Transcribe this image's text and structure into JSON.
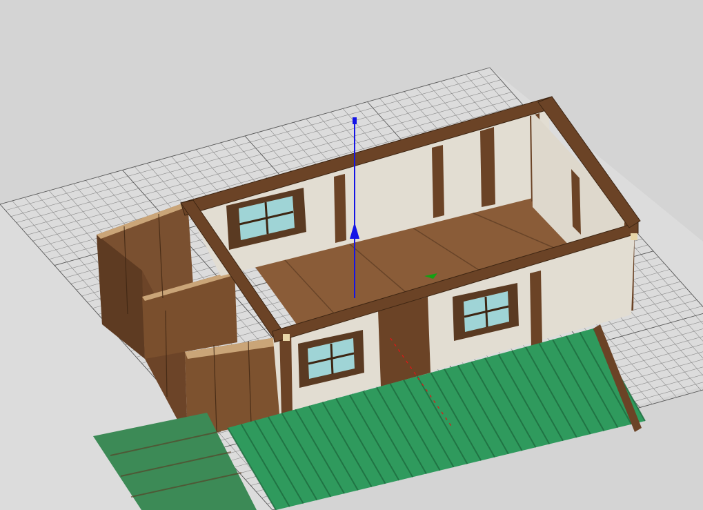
{
  "viewport": {
    "background": "#d4d4d4",
    "grid_line_color": "#8a8a8a",
    "grid_major_color": "#555555"
  },
  "model": {
    "wall_plaster": "#e2ddd2",
    "timber": "#6b4326",
    "timber_dark": "#4a2c18",
    "plank": "#8a5c38",
    "roof_green": "#2f9a5d",
    "roof_green_dark": "#1d6b3e",
    "window_glass": "#9fd4d6",
    "window_frame": "#5a3a22"
  },
  "gizmo": {
    "z_axis_color": "#1414e6",
    "x_axis_color": "#e61414",
    "y_axis_color": "#14a014"
  }
}
